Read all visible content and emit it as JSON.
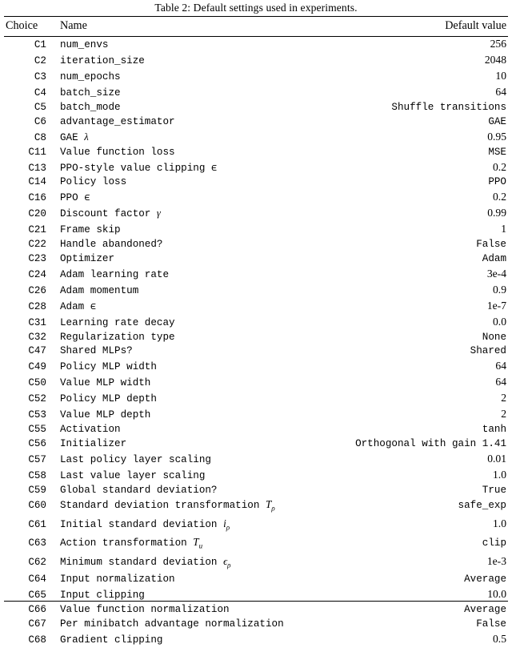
{
  "caption": "Table 2: Default settings used in experiments.",
  "table": {
    "columns": [
      {
        "key": "choice",
        "label": "Choice",
        "align": "left"
      },
      {
        "key": "name",
        "label": "Name",
        "align": "left"
      },
      {
        "key": "value",
        "label": "Default value",
        "align": "right"
      }
    ],
    "rows": [
      {
        "choice": "C1",
        "name": "num_envs",
        "value": "256",
        "value_kind": "num"
      },
      {
        "choice": "C2",
        "name": "iteration_size",
        "value": "2048",
        "value_kind": "num"
      },
      {
        "choice": "C3",
        "name": "num_epochs",
        "value": "10",
        "value_kind": "num"
      },
      {
        "choice": "C4",
        "name": "batch_size",
        "value": "64",
        "value_kind": "num"
      },
      {
        "choice": "C5",
        "name": "batch_mode",
        "value": "Shuffle transitions",
        "value_kind": "mono"
      },
      {
        "choice": "C6",
        "name": "advantage_estimator",
        "value": "GAE",
        "value_kind": "mono"
      },
      {
        "choice": "C8",
        "name": "GAE λ",
        "value": "0.95",
        "value_kind": "num",
        "math": "lambda"
      },
      {
        "choice": "C11",
        "name": "Value function loss",
        "value": "MSE",
        "value_kind": "mono"
      },
      {
        "choice": "C13",
        "name": "PPO-style value clipping ϵ",
        "value": "0.2",
        "value_kind": "num",
        "math": "epsilon"
      },
      {
        "choice": "C14",
        "name": "Policy loss",
        "value": "PPO",
        "value_kind": "mono"
      },
      {
        "choice": "C16",
        "name": "PPO ϵ",
        "value": "0.2",
        "value_kind": "num",
        "math": "epsilon"
      },
      {
        "choice": "C20",
        "name": "Discount factor γ",
        "value": "0.99",
        "value_kind": "num",
        "math": "gamma"
      },
      {
        "choice": "C21",
        "name": "Frame skip",
        "value": "1",
        "value_kind": "num"
      },
      {
        "choice": "C22",
        "name": "Handle abandoned?",
        "value": "False",
        "value_kind": "mono"
      },
      {
        "choice": "C23",
        "name": "Optimizer",
        "value": "Adam",
        "value_kind": "mono"
      },
      {
        "choice": "C24",
        "name": "Adam learning rate",
        "value": "3e-4",
        "value_kind": "num"
      },
      {
        "choice": "C26",
        "name": "Adam momentum",
        "value": "0.9",
        "value_kind": "num"
      },
      {
        "choice": "C28",
        "name": "Adam ϵ",
        "value": "1e-7",
        "value_kind": "num",
        "math": "epsilon"
      },
      {
        "choice": "C31",
        "name": "Learning rate decay",
        "value": "0.0",
        "value_kind": "num"
      },
      {
        "choice": "C32",
        "name": "Regularization type",
        "value": "None",
        "value_kind": "mono"
      },
      {
        "choice": "C47",
        "name": "Shared MLPs?",
        "value": "Shared",
        "value_kind": "mono"
      },
      {
        "choice": "C49",
        "name": "Policy MLP width",
        "value": "64",
        "value_kind": "num"
      },
      {
        "choice": "C50",
        "name": "Value MLP width",
        "value": "64",
        "value_kind": "num"
      },
      {
        "choice": "C52",
        "name": "Policy MLP depth",
        "value": "2",
        "value_kind": "num"
      },
      {
        "choice": "C53",
        "name": "Value MLP depth",
        "value": "2",
        "value_kind": "num"
      },
      {
        "choice": "C55",
        "name": "Activation",
        "value": "tanh",
        "value_kind": "mono"
      },
      {
        "choice": "C56",
        "name": "Initializer",
        "value": "Orthogonal with gain 1.41",
        "value_kind": "mono"
      },
      {
        "choice": "C57",
        "name": "Last policy layer scaling",
        "value": "0.01",
        "value_kind": "num"
      },
      {
        "choice": "C58",
        "name": "Last value layer scaling",
        "value": "1.0",
        "value_kind": "num"
      },
      {
        "choice": "C59",
        "name": "Global standard deviation?",
        "value": "True",
        "value_kind": "mono"
      },
      {
        "choice": "C60",
        "name": "Standard deviation transformation Tρ",
        "value": "safe_exp",
        "value_kind": "mono",
        "math": "T_rho"
      },
      {
        "choice": "C61",
        "name": "Initial standard deviation iρ",
        "value": "1.0",
        "value_kind": "num",
        "math": "i_rho"
      },
      {
        "choice": "C63",
        "name": "Action transformation Tᵤ",
        "value": "clip",
        "value_kind": "mono",
        "math": "T_u"
      },
      {
        "choice": "C62",
        "name": "Minimum standard deviation ϵρ",
        "value": "1e-3",
        "value_kind": "num",
        "math": "epsilon_rho"
      },
      {
        "choice": "C64",
        "name": "Input normalization",
        "value": "Average",
        "value_kind": "mono"
      },
      {
        "choice": "C65",
        "name": "Input clipping",
        "value": "10.0",
        "value_kind": "num"
      },
      {
        "choice": "C66",
        "name": "Value function normalization",
        "value": "Average",
        "value_kind": "mono"
      },
      {
        "choice": "C67",
        "name": "Per minibatch advantage normalization",
        "value": "False",
        "value_kind": "mono"
      },
      {
        "choice": "C68",
        "name": "Gradient clipping",
        "value": "0.5",
        "value_kind": "num"
      }
    ]
  },
  "math_fragments": {
    "lambda": {
      "base": "GAE ",
      "symbol": "λ",
      "sub": ""
    },
    "gamma": {
      "base": "Discount factor ",
      "symbol": "γ",
      "sub": ""
    },
    "T_rho": {
      "base": "Standard deviation transformation ",
      "symbol": "T",
      "sub": "ρ"
    },
    "i_rho": {
      "base": "Initial standard deviation ",
      "symbol": "i",
      "sub": "ρ"
    },
    "T_u": {
      "base": "Action transformation ",
      "symbol": "T",
      "sub": "u"
    },
    "epsilon_rho": {
      "base": "Minimum standard deviation ",
      "symbol": "ϵ",
      "sub": "ρ"
    }
  }
}
